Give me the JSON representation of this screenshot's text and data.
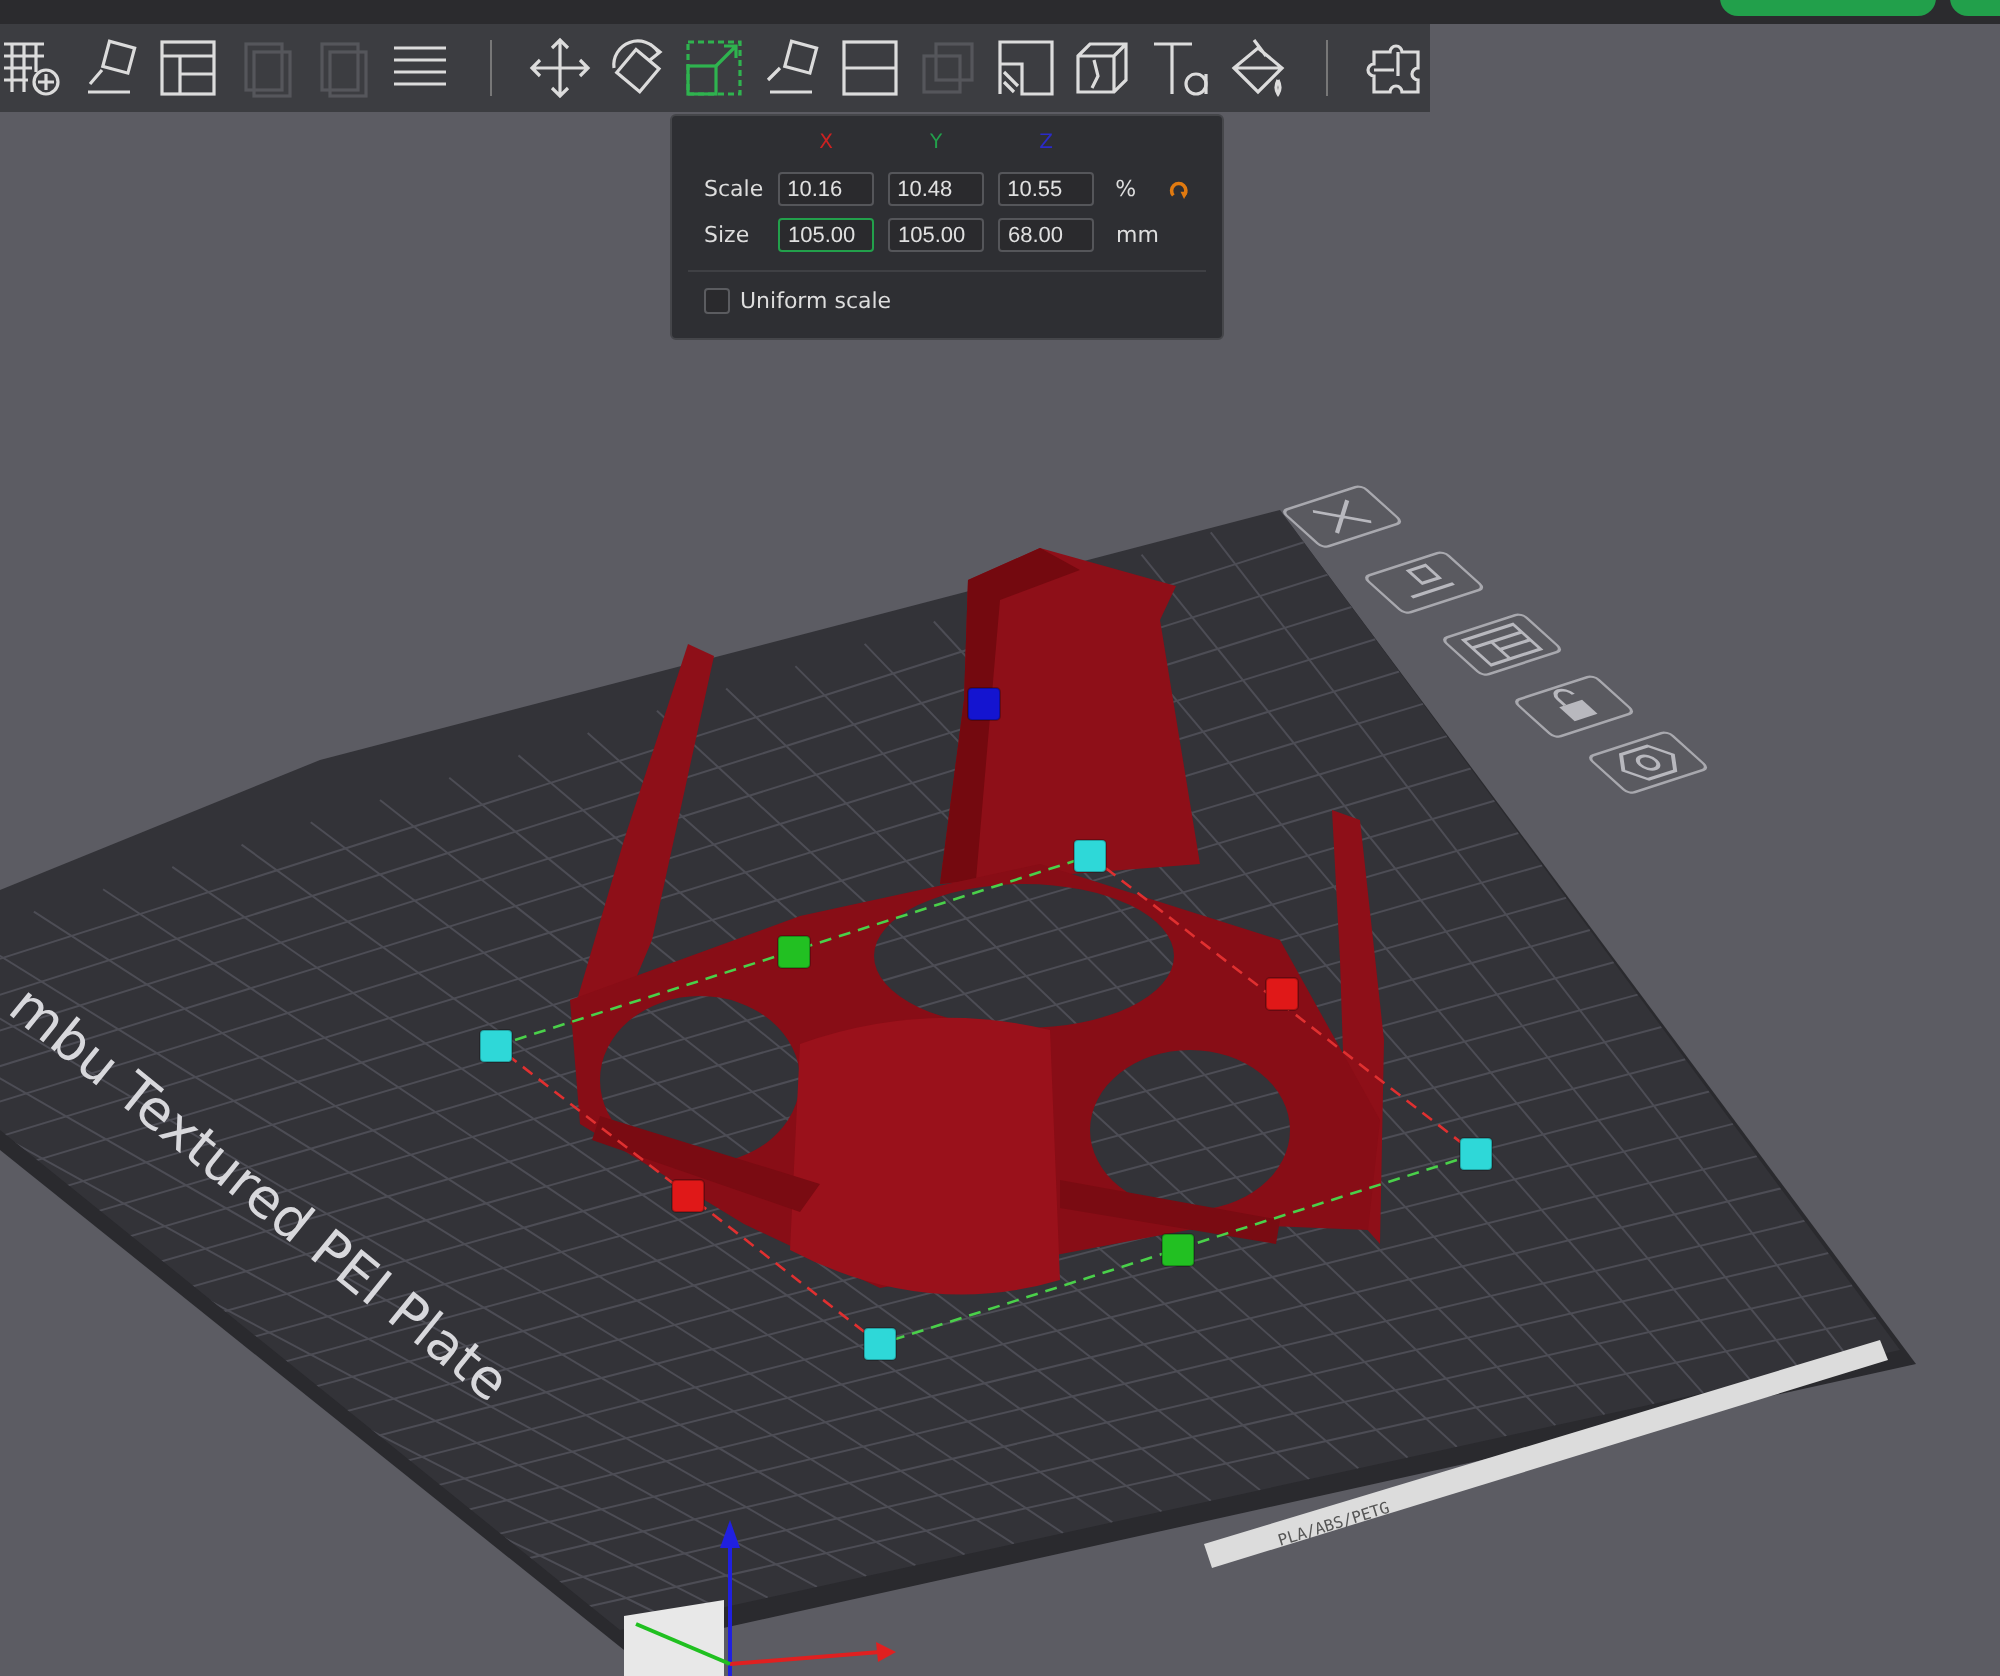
{
  "top_bar": {
    "buttons": [
      {
        "kind": "pill"
      },
      {
        "kind": "pill"
      }
    ]
  },
  "toolbar": {
    "tools": [
      {
        "kind": "tool",
        "selected": false,
        "disabled": false
      },
      {
        "kind": "tool",
        "selected": false,
        "disabled": false
      },
      {
        "kind": "tool",
        "selected": false,
        "disabled": false
      },
      {
        "kind": "tool",
        "selected": false,
        "disabled": true
      },
      {
        "kind": "tool",
        "selected": false,
        "disabled": true
      },
      {
        "kind": "tool",
        "selected": false,
        "disabled": false
      },
      {
        "kind": "separator"
      },
      {
        "kind": "tool",
        "selected": false,
        "disabled": false
      },
      {
        "kind": "tool",
        "selected": false,
        "disabled": false
      },
      {
        "kind": "tool",
        "selected": true,
        "disabled": false
      },
      {
        "kind": "tool",
        "selected": false,
        "disabled": false
      },
      {
        "kind": "tool",
        "selected": false,
        "disabled": false
      },
      {
        "kind": "tool",
        "selected": false,
        "disabled": true
      },
      {
        "kind": "tool",
        "selected": false,
        "disabled": false
      },
      {
        "kind": "tool",
        "selected": false,
        "disabled": false
      },
      {
        "kind": "tool",
        "selected": false,
        "disabled": false
      },
      {
        "kind": "tool",
        "selected": false,
        "disabled": false
      },
      {
        "kind": "separator"
      },
      {
        "kind": "tool",
        "selected": false,
        "disabled": false
      }
    ]
  },
  "scale_panel": {
    "axes": [
      {
        "label": "X",
        "color": "#cc2222"
      },
      {
        "label": "Y",
        "color": "#22a04b"
      },
      {
        "label": "Z",
        "color": "#2b2bc8"
      }
    ],
    "rows": [
      {
        "label": "Scale",
        "values": [
          {
            "value": "10.16",
            "focused": false
          },
          {
            "value": "10.48",
            "focused": false
          },
          {
            "value": "10.55",
            "focused": false
          }
        ],
        "unit": "%",
        "reset": true
      },
      {
        "label": "Size",
        "values": [
          {
            "value": "105.00",
            "focused": true
          },
          {
            "value": "105.00",
            "focused": false
          },
          {
            "value": "68.00",
            "focused": false
          }
        ],
        "unit": "mm"
      }
    ],
    "uniform_scale": {
      "label": "Uniform scale",
      "checked": false
    }
  },
  "plate": {
    "name": "mbu Textured PEI Plate",
    "strip_label": "PLA/ABS/PETG"
  }
}
